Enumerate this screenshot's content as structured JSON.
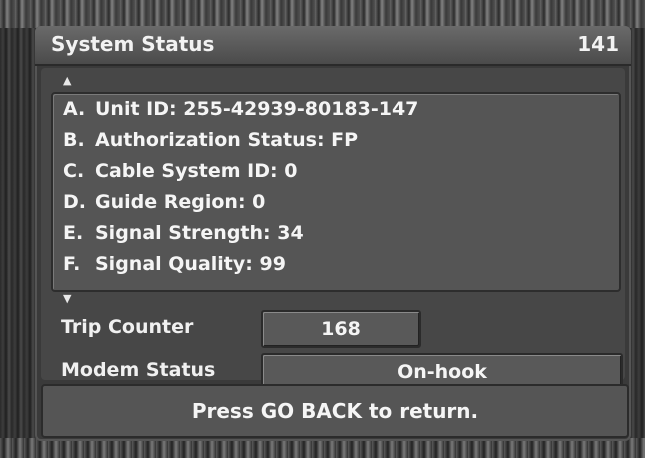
{
  "header": {
    "title": "System Status",
    "channel": "141"
  },
  "status_list": {
    "scroll_up": "▲",
    "scroll_down": "▼",
    "items": [
      {
        "letter": "A.",
        "text": "Unit ID: 255-42939-80183-147"
      },
      {
        "letter": "B.",
        "text": "Authorization Status: FP"
      },
      {
        "letter": "C.",
        "text": "Cable System ID: 0"
      },
      {
        "letter": "D.",
        "text": "Guide Region: 0"
      },
      {
        "letter": "E.",
        "text": "Signal Strength: 34"
      },
      {
        "letter": "F.",
        "text": "Signal Quality: 99"
      }
    ]
  },
  "trip_counter": {
    "label": "Trip Counter",
    "value": "168"
  },
  "modem_status": {
    "label": "Modem Status",
    "value": "On-hook"
  },
  "footer": {
    "text": "Press GO BACK to return."
  }
}
